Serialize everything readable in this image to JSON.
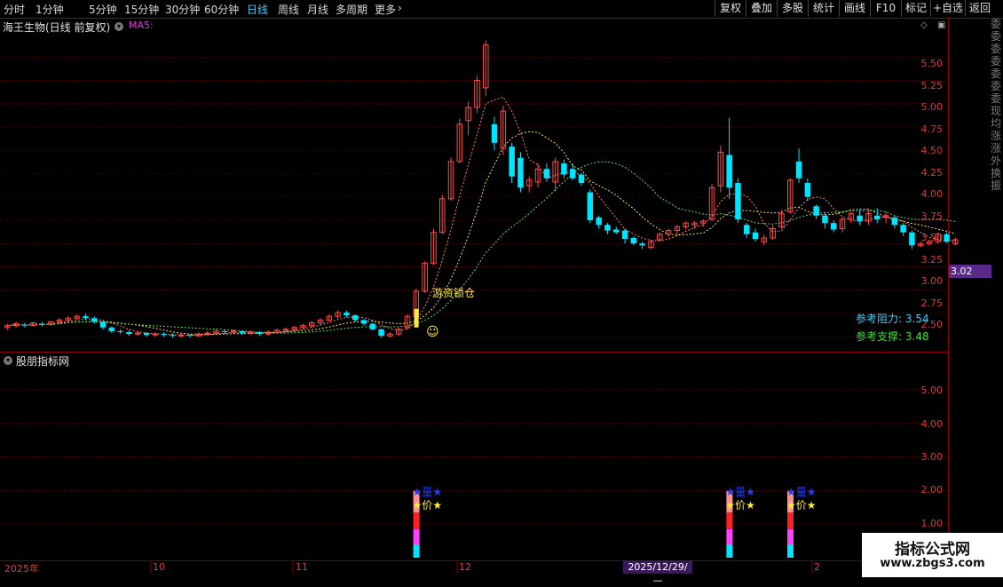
{
  "toolbar": {
    "periods": [
      "分时",
      "1分钟",
      "5分钟",
      "15分钟",
      "30分钟",
      "60分钟",
      "日线",
      "周线",
      "月线",
      "多周期",
      "更多"
    ],
    "active_period": "日线",
    "right_buttons": [
      "复权",
      "叠加",
      "多股",
      "统计",
      "画线",
      "F10",
      "标记",
      "+自选",
      "返回"
    ]
  },
  "chart_header": {
    "title": "海王生物(日线 前复权)",
    "ma_label": "MA5:"
  },
  "price_axis": [
    "5.50",
    "5.25",
    "5.00",
    "4.75",
    "4.50",
    "4.25",
    "4.00",
    "3.75",
    "3.50",
    "3.25",
    "3.00",
    "2.75",
    "2.50"
  ],
  "current_price_tag": "3.02",
  "reference": {
    "resistance_label": "参考阻力:",
    "resistance_value": "3.54",
    "support_label": "参考支撑:",
    "support_value": "3.48"
  },
  "annotation": {
    "text": "游资锁仓"
  },
  "indicator": {
    "title": "股朋指标网",
    "axis": [
      "5.00",
      "4.00",
      "3.00",
      "2.00",
      "1.00"
    ],
    "signal_top": "★量★",
    "signal_bottom": "★价★"
  },
  "date_axis": {
    "labels": [
      "2025年",
      "10",
      "11",
      "12",
      "2"
    ],
    "cursor": "2025/12/29/—"
  },
  "watermark": {
    "line1": "指标公式网",
    "line2": "www.zbgs3.com"
  },
  "right_strip_text": "委委委委委委委现均涨涨外换振",
  "colors": {
    "up": "#ff4a4a",
    "down": "#00e5ff",
    "grid": "#5a0000",
    "accent": "#3ad0ff"
  },
  "chart_data": {
    "type": "candlestick",
    "y_range": [
      2.3,
      5.7
    ],
    "candles": [
      [
        2.6,
        2.62,
        2.57,
        2.64
      ],
      [
        2.62,
        2.64,
        2.6,
        2.66
      ],
      [
        2.63,
        2.62,
        2.6,
        2.65
      ],
      [
        2.62,
        2.65,
        2.61,
        2.66
      ],
      [
        2.64,
        2.63,
        2.61,
        2.66
      ],
      [
        2.63,
        2.66,
        2.62,
        2.67
      ],
      [
        2.66,
        2.68,
        2.64,
        2.7
      ],
      [
        2.68,
        2.7,
        2.66,
        2.72
      ],
      [
        2.7,
        2.72,
        2.68,
        2.74
      ],
      [
        2.72,
        2.7,
        2.68,
        2.75
      ],
      [
        2.7,
        2.66,
        2.64,
        2.72
      ],
      [
        2.66,
        2.6,
        2.58,
        2.67
      ],
      [
        2.6,
        2.56,
        2.54,
        2.61
      ],
      [
        2.56,
        2.55,
        2.53,
        2.58
      ],
      [
        2.55,
        2.53,
        2.51,
        2.57
      ],
      [
        2.53,
        2.54,
        2.51,
        2.56
      ],
      [
        2.54,
        2.52,
        2.5,
        2.55
      ],
      [
        2.52,
        2.53,
        2.5,
        2.55
      ],
      [
        2.53,
        2.52,
        2.5,
        2.55
      ],
      [
        2.52,
        2.51,
        2.49,
        2.54
      ],
      [
        2.51,
        2.52,
        2.49,
        2.54
      ],
      [
        2.52,
        2.51,
        2.49,
        2.53
      ],
      [
        2.51,
        2.53,
        2.5,
        2.55
      ],
      [
        2.53,
        2.54,
        2.51,
        2.56
      ],
      [
        2.54,
        2.56,
        2.52,
        2.58
      ],
      [
        2.56,
        2.55,
        2.53,
        2.58
      ],
      [
        2.55,
        2.56,
        2.53,
        2.58
      ],
      [
        2.56,
        2.54,
        2.52,
        2.57
      ],
      [
        2.54,
        2.55,
        2.52,
        2.57
      ],
      [
        2.55,
        2.53,
        2.51,
        2.56
      ],
      [
        2.53,
        2.55,
        2.51,
        2.57
      ],
      [
        2.55,
        2.57,
        2.53,
        2.59
      ],
      [
        2.57,
        2.58,
        2.55,
        2.6
      ],
      [
        2.58,
        2.6,
        2.56,
        2.62
      ],
      [
        2.6,
        2.62,
        2.58,
        2.64
      ],
      [
        2.62,
        2.65,
        2.6,
        2.67
      ],
      [
        2.65,
        2.68,
        2.63,
        2.7
      ],
      [
        2.68,
        2.72,
        2.66,
        2.74
      ],
      [
        2.72,
        2.76,
        2.7,
        2.78
      ],
      [
        2.76,
        2.73,
        2.71,
        2.78
      ],
      [
        2.73,
        2.68,
        2.66,
        2.74
      ],
      [
        2.68,
        2.64,
        2.62,
        2.69
      ],
      [
        2.64,
        2.58,
        2.57,
        2.65
      ],
      [
        2.58,
        2.51,
        2.49,
        2.59
      ],
      [
        2.51,
        2.53,
        2.49,
        2.55
      ],
      [
        2.53,
        2.58,
        2.51,
        2.6
      ],
      [
        2.6,
        2.72,
        2.58,
        2.74
      ],
      [
        2.72,
        2.99,
        2.7,
        3.02
      ],
      [
        2.99,
        3.29,
        2.97,
        3.31
      ],
      [
        3.29,
        3.62,
        3.27,
        3.66
      ],
      [
        3.62,
        3.98,
        3.6,
        4.02
      ],
      [
        3.98,
        4.38,
        3.96,
        4.42
      ],
      [
        4.38,
        4.78,
        4.36,
        4.84
      ],
      [
        4.82,
        4.96,
        4.66,
        5.02
      ],
      [
        4.96,
        5.25,
        4.9,
        5.3
      ],
      [
        5.17,
        5.63,
        5.08,
        5.68
      ],
      [
        4.78,
        4.58,
        4.5,
        4.86
      ],
      [
        4.52,
        4.92,
        4.45,
        4.98
      ],
      [
        4.54,
        4.22,
        4.15,
        4.58
      ],
      [
        4.42,
        4.1,
        4.05,
        4.48
      ],
      [
        4.12,
        4.18,
        4.05,
        4.22
      ],
      [
        4.16,
        4.3,
        4.1,
        4.36
      ],
      [
        4.3,
        4.2,
        4.16,
        4.36
      ],
      [
        4.16,
        4.38,
        4.06,
        4.42
      ],
      [
        4.36,
        4.24,
        4.2,
        4.4
      ],
      [
        4.3,
        4.2,
        4.18,
        4.36
      ],
      [
        4.24,
        4.15,
        4.12,
        4.26
      ],
      [
        4.05,
        3.75,
        3.72,
        4.08
      ],
      [
        3.78,
        3.7,
        3.66,
        3.8
      ],
      [
        3.7,
        3.64,
        3.6,
        3.72
      ],
      [
        3.65,
        3.62,
        3.6,
        3.68
      ],
      [
        3.64,
        3.55,
        3.5,
        3.66
      ],
      [
        3.56,
        3.5,
        3.48,
        3.58
      ],
      [
        3.5,
        3.48,
        3.44,
        3.52
      ],
      [
        3.46,
        3.52,
        3.44,
        3.54
      ],
      [
        3.54,
        3.6,
        3.52,
        3.62
      ],
      [
        3.6,
        3.64,
        3.57,
        3.66
      ],
      [
        3.64,
        3.68,
        3.6,
        3.7
      ],
      [
        3.68,
        3.72,
        3.65,
        3.74
      ],
      [
        3.7,
        3.72,
        3.66,
        3.74
      ],
      [
        3.72,
        3.74,
        3.68,
        3.76
      ],
      [
        3.76,
        4.1,
        3.74,
        4.14
      ],
      [
        4.12,
        4.48,
        4.05,
        4.55
      ],
      [
        4.45,
        4.1,
        3.98,
        4.85
      ],
      [
        4.15,
        3.76,
        3.72,
        4.2
      ],
      [
        3.7,
        3.6,
        3.56,
        3.72
      ],
      [
        3.62,
        3.55,
        3.52,
        3.66
      ],
      [
        3.52,
        3.56,
        3.48,
        3.6
      ],
      [
        3.56,
        3.66,
        3.54,
        3.7
      ],
      [
        3.68,
        3.82,
        3.66,
        3.86
      ],
      [
        3.84,
        4.18,
        3.82,
        4.2
      ],
      [
        4.38,
        4.2,
        4.15,
        4.52
      ],
      [
        4.15,
        4.0,
        3.96,
        4.2
      ],
      [
        3.9,
        3.8,
        3.76,
        3.92
      ],
      [
        3.8,
        3.72,
        3.66,
        3.84
      ],
      [
        3.72,
        3.65,
        3.62,
        3.75
      ],
      [
        3.66,
        3.76,
        3.62,
        3.78
      ],
      [
        3.76,
        3.82,
        3.72,
        3.84
      ],
      [
        3.8,
        3.74,
        3.7,
        3.86
      ],
      [
        3.74,
        3.82,
        3.7,
        3.86
      ],
      [
        3.8,
        3.76,
        3.72,
        3.88
      ],
      [
        3.78,
        3.8,
        3.72,
        3.84
      ],
      [
        3.78,
        3.7,
        3.66,
        3.8
      ],
      [
        3.7,
        3.62,
        3.58,
        3.72
      ],
      [
        3.62,
        3.48,
        3.44,
        3.64
      ],
      [
        3.48,
        3.5,
        3.46,
        3.52
      ],
      [
        3.5,
        3.52,
        3.48,
        3.54
      ],
      [
        3.52,
        3.6,
        3.5,
        3.62
      ],
      [
        3.6,
        3.52,
        3.5,
        3.62
      ],
      [
        3.5,
        3.54,
        3.48,
        3.56
      ]
    ],
    "signal_days": [
      47,
      83,
      90
    ],
    "indicator_ylim": [
      0,
      5.5
    ]
  }
}
